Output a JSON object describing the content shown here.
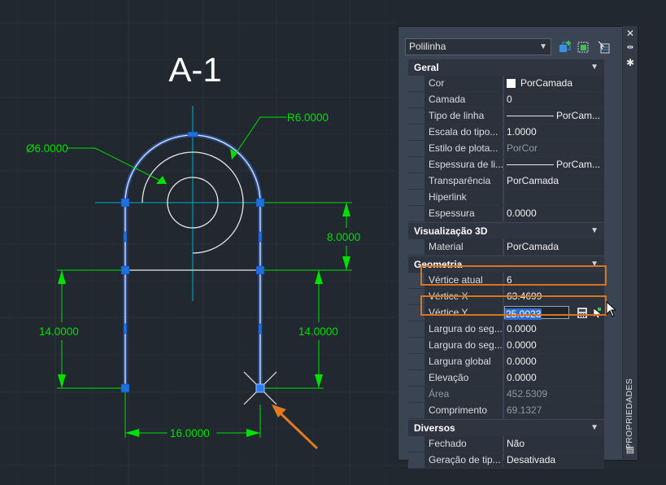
{
  "drawing": {
    "title": "A-1",
    "dim_diameter": "Ø6.0000",
    "dim_radius": "R6.0000",
    "dim_height_top": "8.0000",
    "dim_height_left": "14.0000",
    "dim_height_right": "14.0000",
    "dim_width": "16.0000",
    "colors": {
      "background": "#212830",
      "dimension": "#00e000",
      "object": "#e8e8e8",
      "selected": "#4a88ff",
      "center": "#00b0c0",
      "pointer": "#e07b22"
    }
  },
  "palette": {
    "object_type": "Polilinha",
    "title": "PROPRIEDADES",
    "icons": [
      "close-icon",
      "pin-icon",
      "settings-icon",
      "quick-select-icon",
      "select-objects-icon",
      "toggle-pickadd-icon"
    ],
    "categories": {
      "geral": {
        "label": "Geral",
        "rows": [
          {
            "label": "Cor",
            "value": "PorCamada"
          },
          {
            "label": "Camada",
            "value": "0"
          },
          {
            "label": "Tipo de linha",
            "value": "PorCam..."
          },
          {
            "label": "Escala do tipo...",
            "value": "1.0000"
          },
          {
            "label": "Estilo de plota...",
            "value": "PorCor"
          },
          {
            "label": "Espessura de li...",
            "value": "PorCam..."
          },
          {
            "label": "Transparência",
            "value": "PorCamada"
          },
          {
            "label": "Hiperlink",
            "value": ""
          },
          {
            "label": "Espessura",
            "value": "0.0000"
          }
        ]
      },
      "visualizacao": {
        "label": "Visualização 3D",
        "rows": [
          {
            "label": "Material",
            "value": "PorCamada"
          }
        ]
      },
      "geometria": {
        "label": "Geometria",
        "rows": [
          {
            "label": "Vértice atual",
            "value": "6"
          },
          {
            "label": "Vértice X",
            "value": "63.4699"
          },
          {
            "label": "Vértice Y",
            "value": "25.0023"
          },
          {
            "label": "Largura do seg...",
            "value": "0.0000"
          },
          {
            "label": "Largura do seg...",
            "value": "0.0000"
          },
          {
            "label": "Largura global",
            "value": "0.0000"
          },
          {
            "label": "Elevação",
            "value": "0.0000"
          },
          {
            "label": "Área",
            "value": "452.5309"
          },
          {
            "label": "Comprimento",
            "value": "69.1327"
          }
        ]
      },
      "diversos": {
        "label": "Diversos",
        "rows": [
          {
            "label": "Fechado",
            "value": "Não"
          },
          {
            "label": "Geração de tip...",
            "value": "Desativada"
          }
        ]
      }
    },
    "highlight_color": "#d9731d"
  }
}
